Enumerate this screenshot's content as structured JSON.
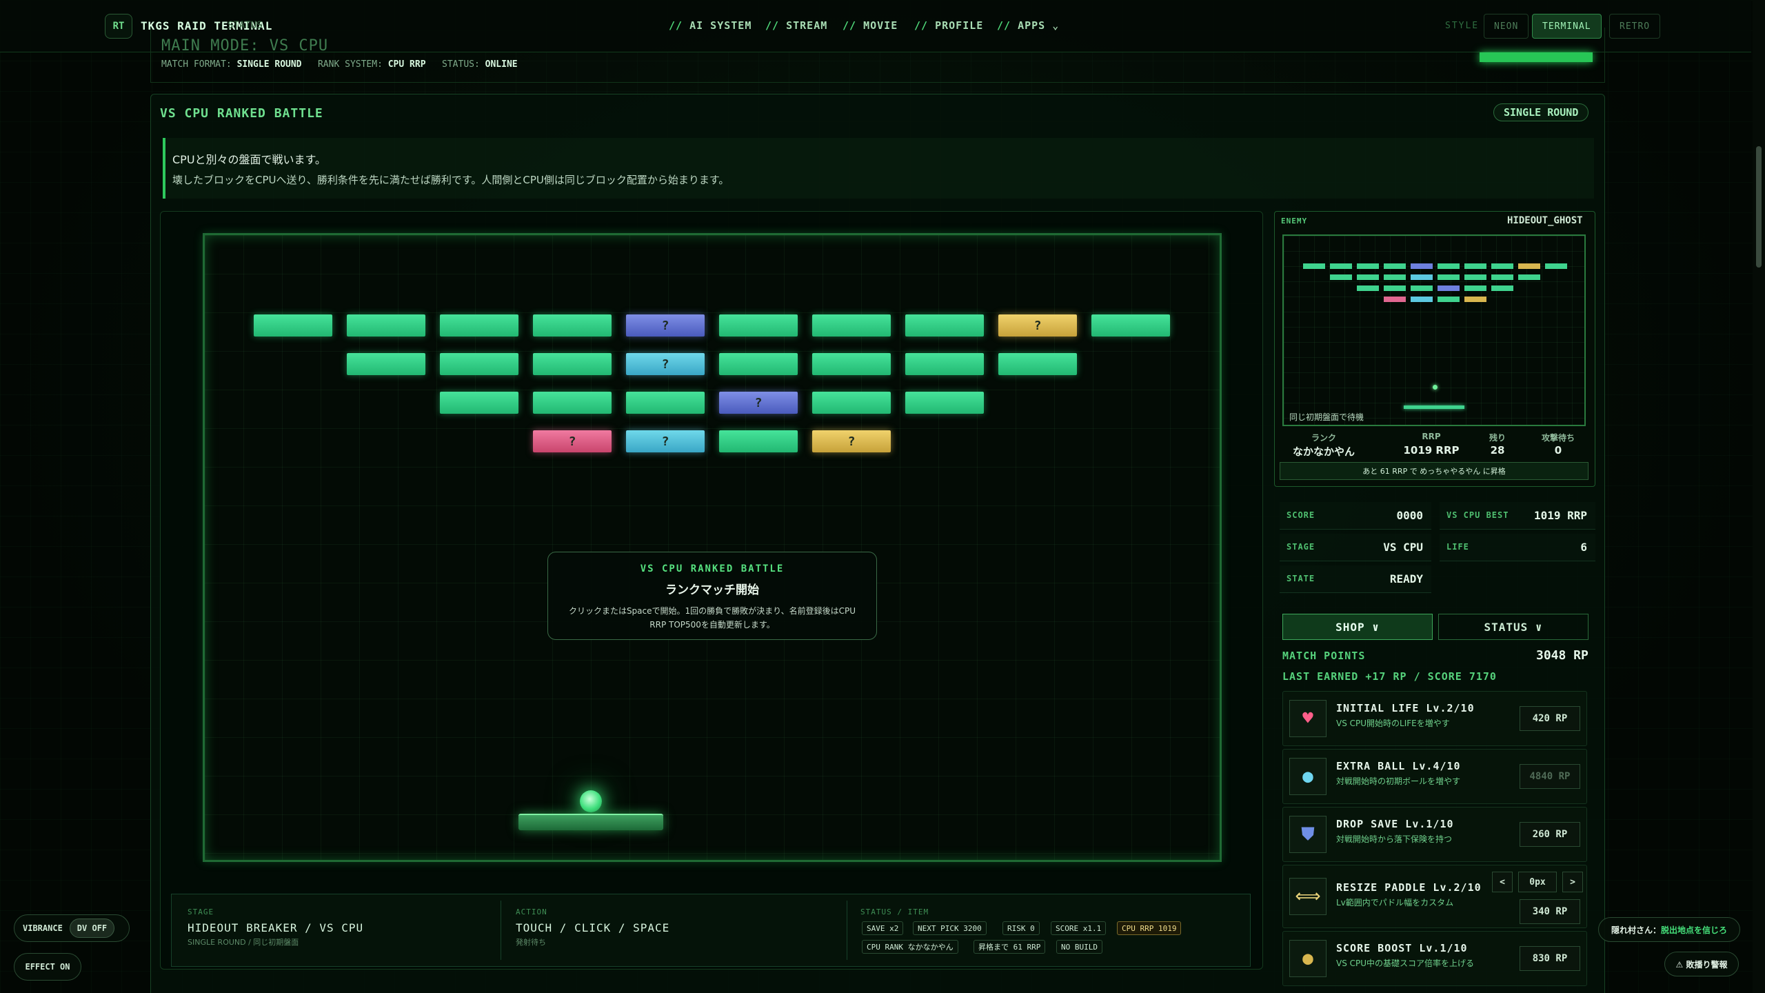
{
  "nav": {
    "logo_badge": "RT",
    "title": "TKGS RAID TERMINAL",
    "ghost": "STATUS",
    "items": [
      "AI SYSTEM",
      "STREAM",
      "MOVIE",
      "PROFILE",
      "APPS"
    ],
    "slash": "//",
    "style_label": "STYLE",
    "styles": [
      "NEON",
      "TERMINAL",
      "RETRO"
    ],
    "active_style": "TERMINAL"
  },
  "mode": {
    "title": "MAIN MODE: VS CPU",
    "format_label": "MATCH FORMAT:",
    "format_value": "SINGLE ROUND",
    "rank_label": "RANK SYSTEM:",
    "rank_value": "CPU RRP",
    "status_label": "STATUS:",
    "status_value": "ONLINE"
  },
  "panel": {
    "title": "VS CPU RANKED BATTLE",
    "pill": "SINGLE ROUND",
    "desc_line1": "CPUと別々の盤面で戦います。",
    "desc_line2": "壊したブロックをCPUへ送り、勝利条件を先に満たせば勝利です。人間側とCPU側は同じブロック配置から始まります。"
  },
  "game": {
    "overlay_title": "VS CPU RANKED BATTLE",
    "overlay_sub": "ランクマッチ開始",
    "overlay_text": "クリックまたはSpaceで開始。1回の勝負で勝敗が決まり、名前登録後はCPU RRP TOP500を自動更新します。",
    "mystery_glyph": "?",
    "bricks": [
      [
        "green",
        "green",
        "green",
        "green",
        "blue",
        "green",
        "green",
        "green",
        "gold",
        "green"
      ],
      [
        null,
        "green",
        "green",
        "green",
        "cyan",
        "green",
        "green",
        "green",
        "green",
        null
      ],
      [
        null,
        null,
        "green",
        "green",
        "green",
        "blue",
        "green",
        "green",
        null,
        null
      ],
      [
        null,
        null,
        null,
        "pink",
        "cyan",
        "green",
        "gold",
        null,
        null,
        null
      ]
    ],
    "mystery": [
      [
        0,
        4
      ],
      [
        0,
        8
      ],
      [
        1,
        4
      ],
      [
        2,
        5
      ],
      [
        3,
        3
      ],
      [
        3,
        4
      ],
      [
        3,
        6
      ]
    ]
  },
  "info": {
    "stage_label": "STAGE",
    "stage_value": "HIDEOUT BREAKER / VS CPU",
    "stage_small": "SINGLE ROUND / 同じ初期盤面",
    "action_label": "ACTION",
    "action_value": "TOUCH / CLICK / SPACE",
    "action_small": "発射待ち",
    "status_label": "STATUS / ITEM",
    "chips_row1": [
      "SAVE x2",
      "NEXT PICK 3200",
      "RISK 0",
      "SCORE x1.1",
      "CPU RRP 1019"
    ],
    "chips_row2": [
      "CPU RANK なかなかやん",
      "昇格まで 61 RRP",
      "NO BUILD"
    ]
  },
  "enemy": {
    "label": "ENEMY",
    "name": "HIDEOUT_GHOST",
    "wait_text": "同じ初期盤面で待機",
    "mini_bricks": [
      [
        "green",
        "green",
        "green",
        "green",
        "blue",
        "green",
        "green",
        "green",
        "gold",
        "green"
      ],
      [
        null,
        "green",
        "green",
        "green",
        "cyan",
        "green",
        "green",
        "green",
        "green",
        null
      ],
      [
        null,
        null,
        "green",
        "green",
        "green",
        "blue",
        "green",
        "green",
        null,
        null
      ],
      [
        null,
        null,
        null,
        "pink",
        "cyan",
        "green",
        "gold",
        null,
        null,
        null
      ]
    ],
    "stats": [
      {
        "label": "ランク",
        "value": "なかなかやん"
      },
      {
        "label": "RRP",
        "value": "1019 RRP"
      },
      {
        "label": "残り",
        "value": "28"
      },
      {
        "label": "攻撃待ち",
        "value": "0"
      }
    ],
    "promo": "あと 61 RRP で めっちゃやるやん に昇格"
  },
  "stats": {
    "score_label": "SCORE",
    "score_value": "0000",
    "best_label": "VS CPU BEST",
    "best_value": "1019 RRP",
    "stage_label": "STAGE",
    "stage_value": "VS CPU",
    "life_label": "LIFE",
    "life_value": "6",
    "state_label": "STATE",
    "state_value": "READY"
  },
  "shop": {
    "tab_shop": "SHOP ∨",
    "tab_status": "STATUS ∨",
    "mp_label": "MATCH POINTS",
    "mp_value": "3048 RP",
    "last_earned": "LAST EARNED +17 RP / SCORE 7170",
    "items": [
      {
        "icon": "heart-icon",
        "glyph": "♥",
        "color": "#ff5f8a",
        "name": "INITIAL LIFE Lv.2/10",
        "desc": "VS CPU開始時のLIFEを増やす",
        "price": "420 RP",
        "dim": false
      },
      {
        "icon": "ball-icon",
        "glyph": "●",
        "color": "#6fd6f0",
        "name": "EXTRA BALL Lv.4/10",
        "desc": "対戦開始時の初期ボールを増やす",
        "price": "4840 RP",
        "dim": true
      },
      {
        "icon": "shield-icon",
        "glyph": "⛊",
        "color": "#6f8fe6",
        "name": "DROP SAVE Lv.1/10",
        "desc": "対戦開始時から落下保険を持つ",
        "price": "260 RP",
        "dim": false
      },
      {
        "icon": "resize-icon",
        "glyph": "⟺",
        "color": "#e8d27a",
        "name": "RESIZE PADDLE Lv.2/10",
        "desc": "Lv範囲内でパドル幅をカスタム",
        "price": "340 RP",
        "dim": false
      },
      {
        "icon": "coin-icon",
        "glyph": "●",
        "color": "#d8b64f",
        "name": "SCORE BOOST Lv.1/10",
        "desc": "VS CPU中の基礎スコア倍率を上げる",
        "price": "830 RP",
        "dim": false
      }
    ],
    "stepper_prev": "<",
    "stepper_value": "0px",
    "stepper_next": ">"
  },
  "floating": {
    "vibrance_label": "VIBRANCE",
    "vibrance_toggle": "DV OFF",
    "effect": "EFFECT ON",
    "notice_prefix": "隠れ村さん：",
    "notice_highlight": "脱出地点を信じろ",
    "alert": "⚠ 敗播り警報"
  }
}
